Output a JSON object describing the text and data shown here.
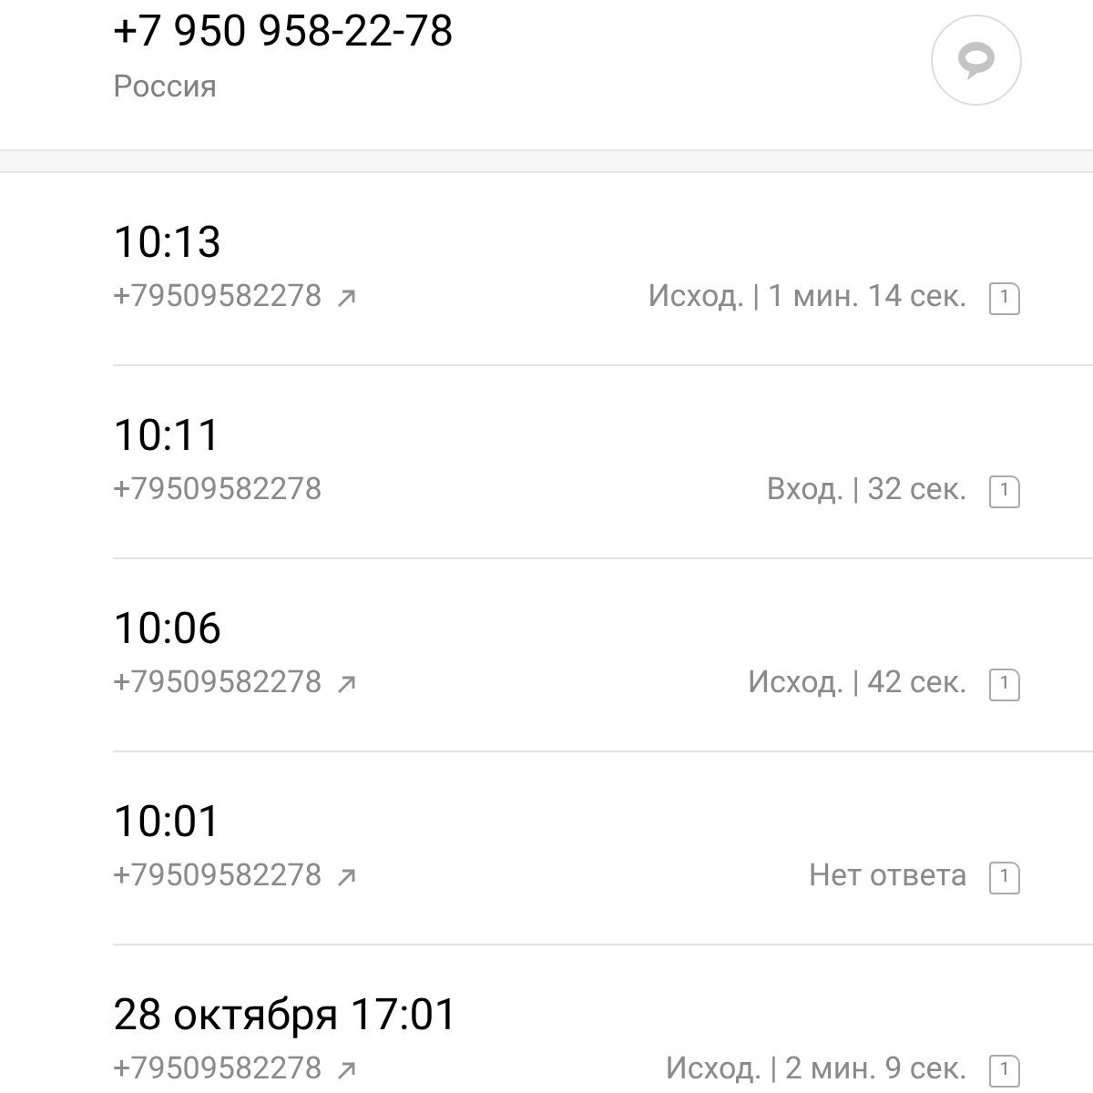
{
  "contact": {
    "phone": "+7 950 958-22-78",
    "country": "Россия"
  },
  "calls": [
    {
      "time": "10:13",
      "number": "+79509582278",
      "outgoing": true,
      "details": "Исход. | 1 мин. 14 сек.",
      "sim": "1"
    },
    {
      "time": "10:11",
      "number": "+79509582278",
      "outgoing": false,
      "details": "Вход. | 32 сек.",
      "sim": "1"
    },
    {
      "time": "10:06",
      "number": "+79509582278",
      "outgoing": true,
      "details": "Исход. | 42 сек.",
      "sim": "1"
    },
    {
      "time": "10:01",
      "number": "+79509582278",
      "outgoing": true,
      "details": "Нет ответа",
      "sim": "1"
    },
    {
      "time": "28 октября 17:01",
      "number": "+79509582278",
      "outgoing": true,
      "details": "Исход. | 2 мин. 9 сек.",
      "sim": "1"
    }
  ]
}
